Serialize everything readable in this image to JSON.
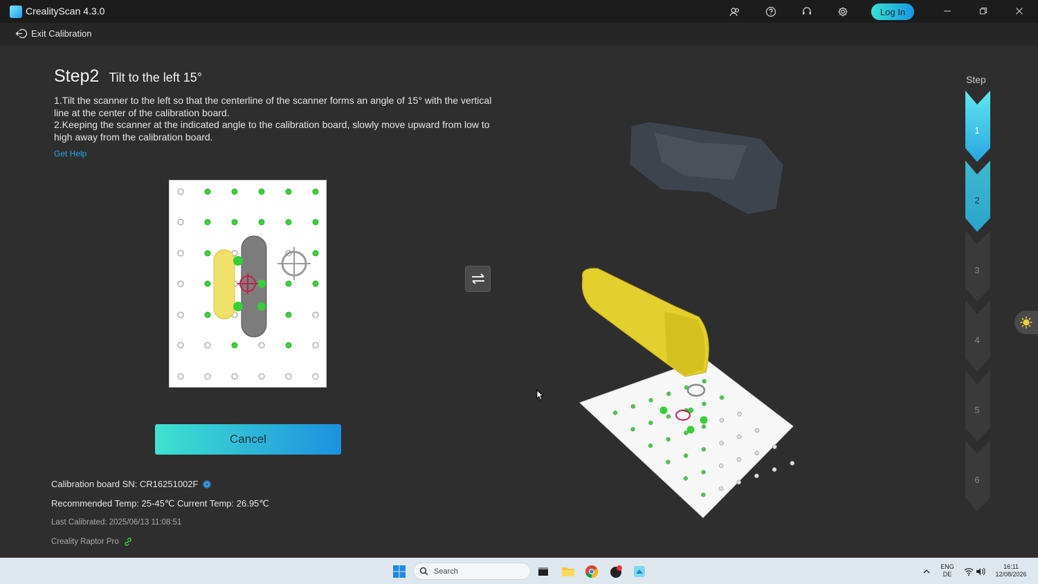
{
  "app": {
    "title": "CrealityScan 4.3.0",
    "login_label": "Log In"
  },
  "toolbar_icons": [
    "community-icon",
    "help-icon",
    "support-icon",
    "gear-icon"
  ],
  "colors": {
    "accent_start": "#3fe2cf",
    "accent_end": "#1d90e0",
    "link": "#2aa7e6",
    "dot_green": "#3ecf3e",
    "target_red": "#c02050"
  },
  "subbar": {
    "exit_label": "Exit Calibration"
  },
  "step": {
    "number": "Step2",
    "subtitle": "Tilt to the left 15°",
    "instruction_1": "1.Tilt the scanner to the left so that the centerline of the scanner forms an angle of 15° with the vertical line at the center of the calibration board.",
    "instruction_2": "2.Keeping the scanner at the indicated angle to the calibration board, slowly move upward from low to high away from the calibration board.",
    "help_link": "Get Help"
  },
  "cancel_label": "Cancel",
  "info": {
    "board_sn": "Calibration board SN: CR16251002F",
    "temp": "Recommended Temp: 25-45℃ Current Temp: 26.95℃",
    "last_calibrated": "Last Calibrated: 2025/06/13 11:08:51",
    "device": "Creality Raptor Pro"
  },
  "steps_panel": {
    "label": "Step",
    "items": [
      "1",
      "2",
      "3",
      "4",
      "5",
      "6"
    ],
    "completed": 1,
    "current": 2
  },
  "taskbar": {
    "search_placeholder": "Search",
    "lang_top": "ENG",
    "lang_bottom": "DE",
    "time": "16:11",
    "date": "12/08/2026"
  }
}
